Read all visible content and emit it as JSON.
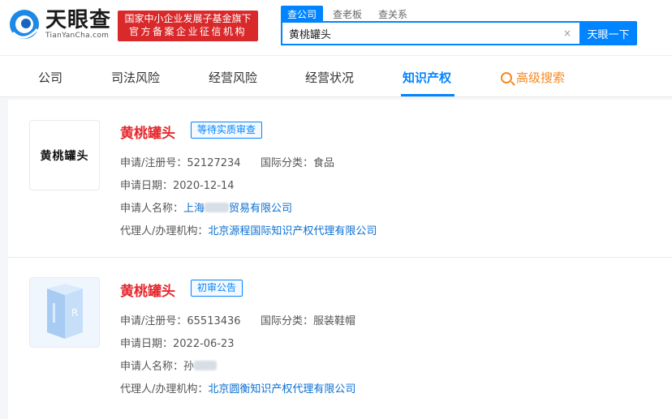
{
  "header": {
    "logo_cn": "天眼查",
    "logo_en": "TianYanCha.com",
    "slogan_line1": "国家中小企业发展子基金旗下",
    "slogan_line2": "官方备案企业征信机构",
    "search_tabs": [
      "查公司",
      "查老板",
      "查关系"
    ],
    "search_value": "黄桃罐头",
    "search_button": "天眼一下",
    "clear_glyph": "×"
  },
  "nav": {
    "items": [
      "公司",
      "司法风险",
      "经营风险",
      "经营状况",
      "知识产权"
    ],
    "advanced": "高级搜索"
  },
  "results": [
    {
      "thumb_text": "黄桃罐头",
      "title": "黄桃罐头",
      "status": "等待实质审查",
      "reg_label": "申请/注册号：",
      "reg_no": "52127234",
      "class_label": "国际分类：",
      "class": "食品",
      "date_label": "申请日期：",
      "date": "2020-12-14",
      "applicant_label": "申请人名称：",
      "applicant_prefix": "上海",
      "applicant_suffix": "贸易有限公司",
      "agent_label": "代理人/办理机构：",
      "agent": "北京源程国际知识产权代理有限公司"
    },
    {
      "title": "黄桃罐头",
      "status": "初审公告",
      "reg_label": "申请/注册号：",
      "reg_no": "65513436",
      "class_label": "国际分类：",
      "class": "服装鞋帽",
      "date_label": "申请日期：",
      "date": "2022-06-23",
      "applicant_label": "申请人名称：",
      "applicant_prefix": "孙",
      "agent_label": "代理人/办理机构：",
      "agent": "北京圆衡知识产权代理有限公司"
    }
  ],
  "colors": {
    "brand_blue": "#0084ff",
    "title_red": "#e5262c",
    "slogan_red": "#d9292b",
    "advanced_orange": "#f5891f"
  }
}
